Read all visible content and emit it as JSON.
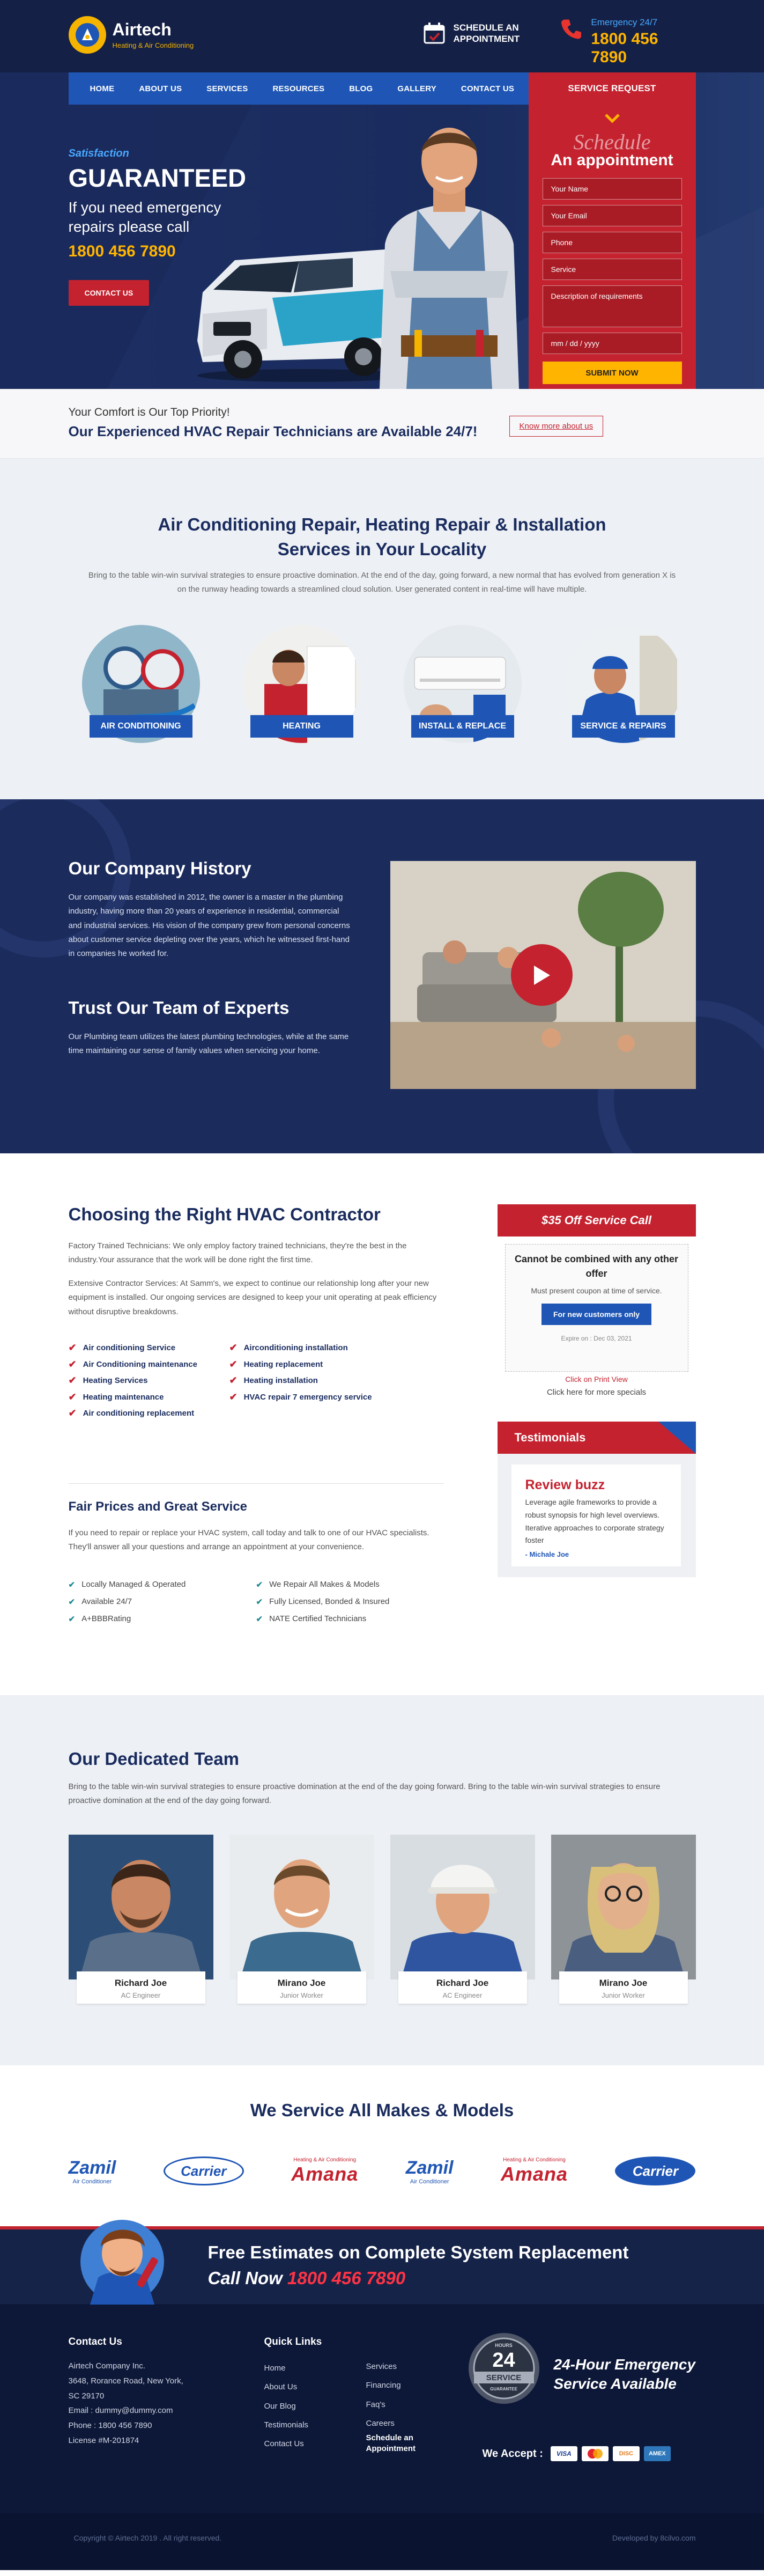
{
  "header": {
    "brand": "Airtech",
    "brand_sub": "Heating & Air Conditioning",
    "schedule_line1": "SCHEDULE AN",
    "schedule_line2": "APPOINTMENT",
    "emergency_label": "Emergency 24/7",
    "emergency_phone": "1800 456 7890"
  },
  "nav": {
    "items": [
      "HOME",
      "ABOUT US",
      "SERVICES",
      "RESOURCES",
      "BLOG",
      "GALLERY",
      "CONTACT US"
    ],
    "request": "SERVICE REQUEST"
  },
  "hero": {
    "eyebrow": "Satisfaction",
    "title": "GUARANTEED",
    "line1": "If you need emergency",
    "line2": "repairs please call",
    "phone": "1800 456 7890",
    "button": "CONTACT US"
  },
  "form": {
    "script": "Schedule",
    "title": "An appointment",
    "fields": [
      "Your Name",
      "Your Email",
      "Phone",
      "Service",
      "Description of requirements",
      "mm / dd / yyyy"
    ],
    "submit": "SUBMIT NOW"
  },
  "strip": {
    "line1": "Your Comfort is Our Top Priority!",
    "line2": "Our Experienced HVAC Repair Technicians are Available 24/7!",
    "button": "Know more about us"
  },
  "services": {
    "title1": "Air Conditioning Repair, Heating Repair & Installation",
    "title2": "Services in Your Locality",
    "text": "Bring to the table win-win survival strategies to ensure proactive domination. At the end of the day, going forward, a new normal that has evolved from generation X is on the runway heading towards a streamlined cloud solution. User generated content in real-time will have multiple.",
    "items": [
      "AIR CONDITIONING",
      "HEATING",
      "INSTALL & REPLACE",
      "SERVICE & REPAIRS"
    ]
  },
  "history": {
    "title": "Our Company History",
    "text": "Our company was established in 2012, the owner is a master in the plumbing industry, having more than 20 years of experience in residential, commercial and industrial services. His vision of the company grew from personal concerns about customer service depleting over the years, which he witnessed first-hand in companies he worked for.",
    "title2": "Trust Our Team of Experts",
    "text2": "Our Plumbing team utilizes the latest plumbing technologies, while at the same time maintaining our sense of family values when servicing your home."
  },
  "contractor": {
    "title": "Choosing the Right HVAC Contractor",
    "p1": "Factory Trained Technicians: We only employ factory trained technicians, they're the best in the industry.Your assurance that the work will be done right the first time.",
    "p2": "Extensive Contractor Services: At Samm's, we expect to continue our relationship long after your new equipment is installed. Our ongoing services are designed to keep your unit operating at peak efficiency without disruptive breakdowns.",
    "checks": [
      "Air conditioning Service",
      "Airconditioning installation",
      "Air Conditioning maintenance",
      "Heating replacement",
      "Heating Services",
      "Heating installation",
      "Heating maintenance",
      "HVAC repair 7 emergency service",
      "Air conditioning replacement"
    ],
    "fair_title": "Fair Prices and Great Service",
    "fair_text": "If you need to repair or replace your HVAC system, call today and talk to one of our HVAC specialists. They'll answer all your questions and arrange an appointment at your convenience.",
    "checks2": [
      "Locally Managed & Operated",
      "We Repair All Makes & Models",
      "Available 24/7",
      "Fully Licensed, Bonded & Insured",
      "A+BBBRating",
      "NATE Certified Technicians"
    ]
  },
  "coupon": {
    "title": "$35 Off Service Call",
    "bold": "Cannot be combined with any other offer",
    "note": "Must present coupon at time of service.",
    "button": "For new customers only",
    "expire": "Expire on : Dec 03, 2021",
    "print": "Click on Print View",
    "more": "Click here for more specials"
  },
  "testimonial": {
    "title": "Testimonials",
    "heading": "Review buzz",
    "text": "Leverage agile frameworks to provide a robust synopsis for high level overviews. Iterative approaches to corporate strategy foster",
    "author": "- Michale Joe"
  },
  "team": {
    "title": "Our Dedicated Team",
    "text": "Bring to the table win-win survival strategies to ensure proactive domination at the end of the day going forward. Bring to the table win-win survival strategies to ensure proactive domination at the end of the day going forward.",
    "members": [
      {
        "name": "Richard Joe",
        "role": "AC Engineer"
      },
      {
        "name": "Mirano Joe",
        "role": "Junior Worker"
      },
      {
        "name": "Richard Joe",
        "role": "AC Engineer"
      },
      {
        "name": "Mirano Joe",
        "role": "Junior Worker"
      }
    ]
  },
  "brands": {
    "title": "We Service All Makes & Models",
    "logos": [
      "Zamil",
      "Carrier",
      "Amana",
      "Zamil",
      "Amana",
      "Carrier"
    ],
    "zamil_sub": "Air Conditioner",
    "amana_sub": "Heating & Air Conditioning"
  },
  "banner": {
    "title": "Free Estimates on Complete System Replacement",
    "call": "Call Now",
    "phone": "1800 456 7890"
  },
  "footer": {
    "contact_title": "Contact Us",
    "address1": "Airtech Company Inc.",
    "address2": "3648, Rorance Road, New York,",
    "address3": "SC 29170",
    "email": "Email : dummy@dummy.com",
    "phone": "Phone : 1800 456 7890",
    "license": "License #M-201874",
    "quick_title": "Quick Links",
    "links1": [
      "Home",
      "About Us",
      "Our Blog",
      "Testimonials",
      "Contact Us"
    ],
    "links2": [
      "Services",
      "Financing",
      "Faq's",
      "Careers",
      "Schedule an Appointment"
    ],
    "badge_num": "24",
    "badge_top": "HOURS",
    "badge_word": "SERVICE",
    "badge_bottom": "GUARANTEE",
    "emergency1": "24-Hour Emergency",
    "emergency2": "Service Available",
    "accept": "We Accept :",
    "cards": [
      "VISA",
      "MC",
      "DISC",
      "AMEX"
    ],
    "copyright": "Copyright © Airtech 2019 . All right reserved.",
    "developer": "Developed by 8cilvo.com"
  },
  "colors": {
    "navy": "#1a2c5e",
    "blue": "#1f56b5",
    "red": "#c4222f",
    "yellow": "#ffb400"
  }
}
